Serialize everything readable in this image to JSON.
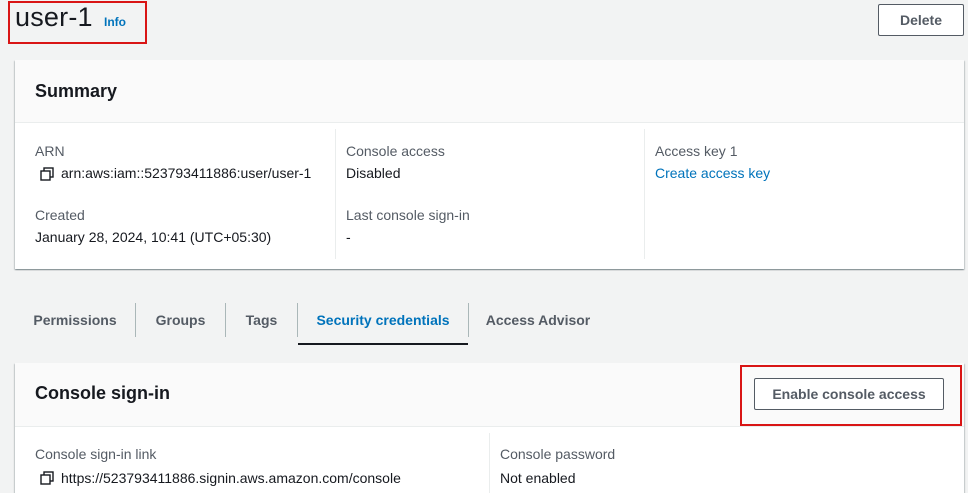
{
  "header": {
    "title": "user-1",
    "info_label": "Info",
    "delete_label": "Delete"
  },
  "summary": {
    "title": "Summary",
    "arn_label": "ARN",
    "arn_value": "arn:aws:iam::523793411886:user/user-1",
    "created_label": "Created",
    "created_value": "January 28, 2024, 10:41 (UTC+05:30)",
    "console_access_label": "Console access",
    "console_access_value": "Disabled",
    "last_signin_label": "Last console sign-in",
    "last_signin_value": "-",
    "access_key_label": "Access key 1",
    "access_key_link": "Create access key"
  },
  "tabs": [
    {
      "label": "Permissions"
    },
    {
      "label": "Groups"
    },
    {
      "label": "Tags"
    },
    {
      "label": "Security credentials",
      "active": true
    },
    {
      "label": "Access Advisor"
    }
  ],
  "console_signin": {
    "title": "Console sign-in",
    "enable_button_label": "Enable console access",
    "link_label": "Console sign-in link",
    "link_value": "https://523793411886.signin.aws.amazon.com/console",
    "password_label": "Console password",
    "password_value": "Not enabled"
  },
  "colors": {
    "link": "#0073bb",
    "highlight": "#d91515",
    "text_primary": "#16191f",
    "text_secondary": "#545b64"
  },
  "icons": [
    "copy-icon"
  ]
}
